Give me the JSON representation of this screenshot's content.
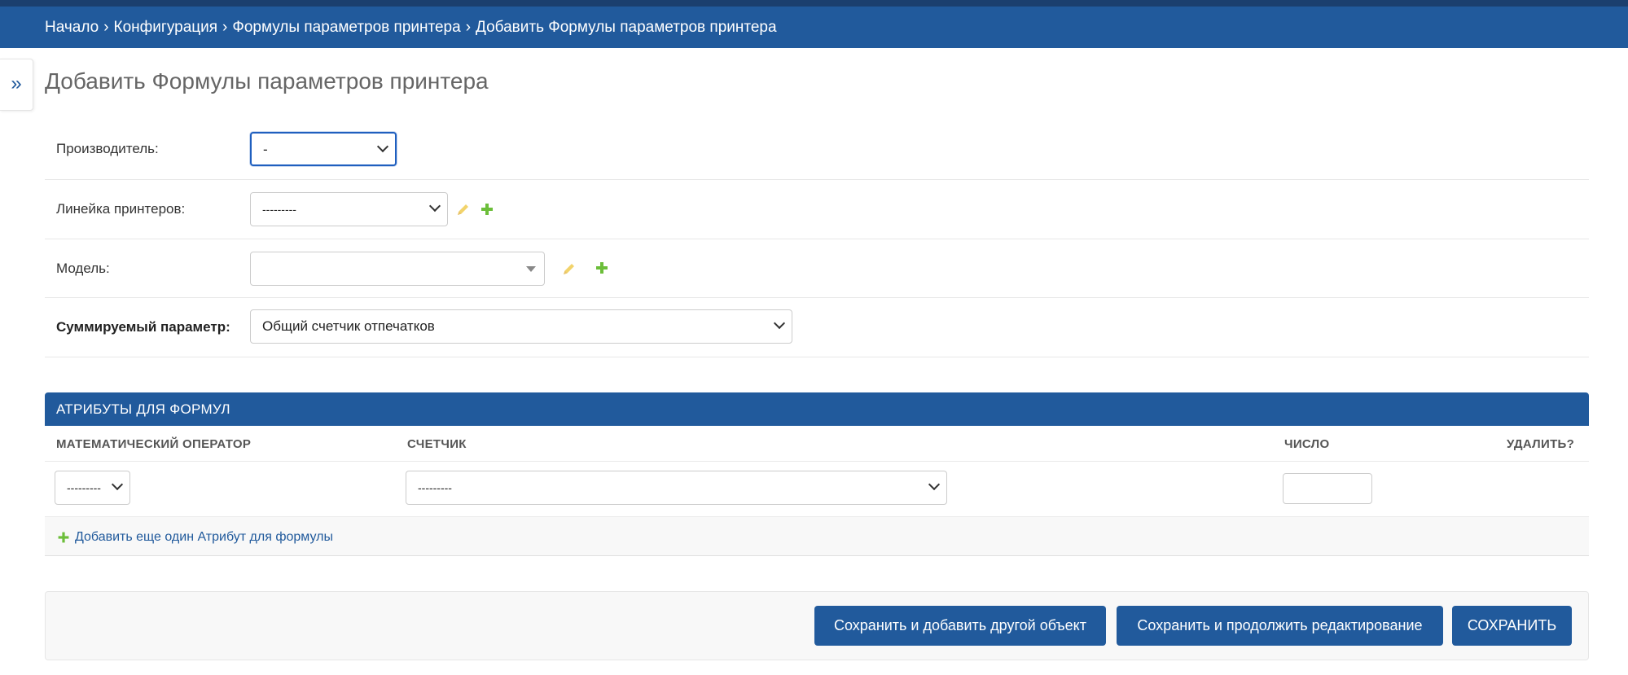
{
  "breadcrumbs": {
    "home": "Начало",
    "section": "Конфигурация",
    "model": "Формулы параметров принтера",
    "current": "Добавить Формулы параметров принтера",
    "separator": "›"
  },
  "nav_toggle": "»",
  "page_title": "Добавить Формулы параметров принтера",
  "form": {
    "manufacturer": {
      "label": "Производитель:",
      "value": "-"
    },
    "printer_line": {
      "label": "Линейка принтеров:",
      "value": "---------"
    },
    "model": {
      "label": "Модель:",
      "value": ""
    },
    "summed_parameter": {
      "label": "Суммируемый параметр:",
      "value": "Общий счетчик отпечатков"
    }
  },
  "inline": {
    "title": "АТРИБУТЫ ДЛЯ ФОРМУЛ",
    "columns": {
      "operator": "МАТЕМАТИЧЕСКИЙ ОПЕРАТОР",
      "counter": "СЧЕТЧИК",
      "number": "ЧИСЛО",
      "delete": "УДАЛИТЬ?"
    },
    "row": {
      "operator_value": "---------",
      "counter_value": "---------",
      "number_value": ""
    },
    "add_label": "Добавить еще один Атрибут для формулы"
  },
  "buttons": {
    "save_add_another": "Сохранить и добавить другой объект",
    "save_continue": "Сохранить и продолжить редактирование",
    "save": "СОХРАНИТЬ"
  },
  "icons": {
    "edit": "pencil-icon",
    "add": "plus-icon",
    "dropdown": "chevron-down-icon"
  },
  "colors": {
    "primary": "#215a9c",
    "topbar": "#1b3f6e",
    "add_green": "#6cbe3a",
    "edit_yellow": "#f2d36b"
  }
}
